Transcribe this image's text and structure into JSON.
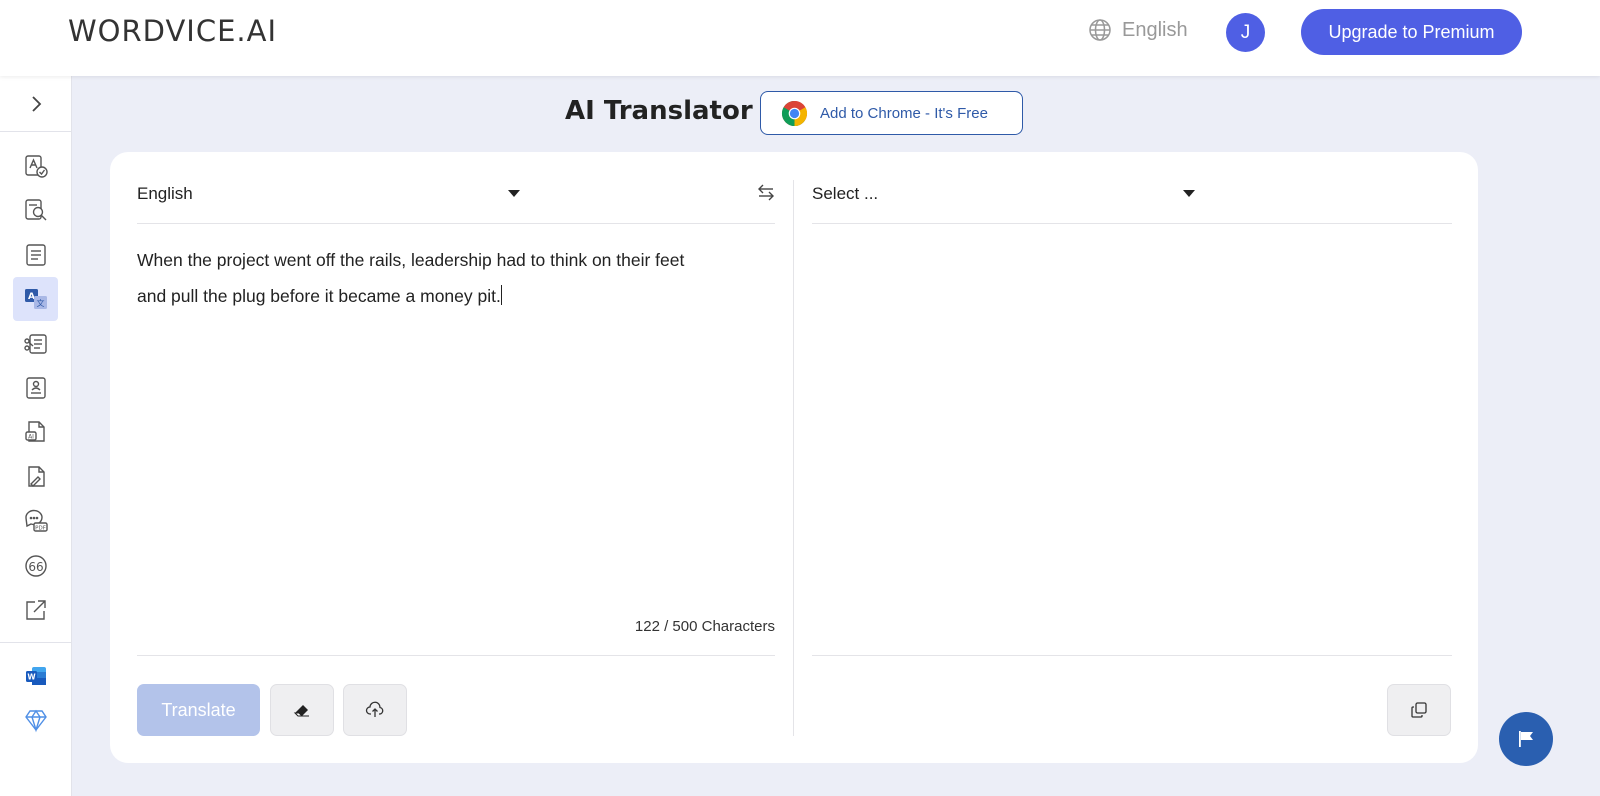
{
  "header": {
    "logo_text": "WORDVICE.AI",
    "language_label": "English",
    "avatar_initial": "J",
    "upgrade_label": "Upgrade to Premium"
  },
  "sidebar": {
    "items": [
      {
        "icon": "grammar-check-icon"
      },
      {
        "icon": "document-search-icon"
      },
      {
        "icon": "summarizer-icon"
      },
      {
        "icon": "translator-icon",
        "active": true
      },
      {
        "icon": "paraphraser-icon"
      },
      {
        "icon": "resume-icon"
      },
      {
        "icon": "ai-detector-icon"
      },
      {
        "icon": "pdf-edit-icon"
      },
      {
        "icon": "chat-pdf-icon"
      },
      {
        "icon": "citation-icon"
      },
      {
        "icon": "external-link-icon"
      }
    ],
    "bottom_items": [
      {
        "icon": "word-addin-icon"
      },
      {
        "icon": "premium-diamond-icon"
      }
    ]
  },
  "page": {
    "title": "AI Translator",
    "chrome_cta": "Add to Chrome - It's Free"
  },
  "translator": {
    "source_language": "English",
    "target_language": "Select ...",
    "source_text_line1": "When the project went off the rails, leadership had to think on their feet",
    "source_text_line2": "and pull the plug before it became a money pit.",
    "char_count": "122 / 500 Characters",
    "translate_label": "Translate"
  },
  "colors": {
    "accent": "#4f5fe4",
    "translate_disabled": "#b3c3ea",
    "chrome_border": "#2f5aa8",
    "fab": "#2a5fb0"
  }
}
